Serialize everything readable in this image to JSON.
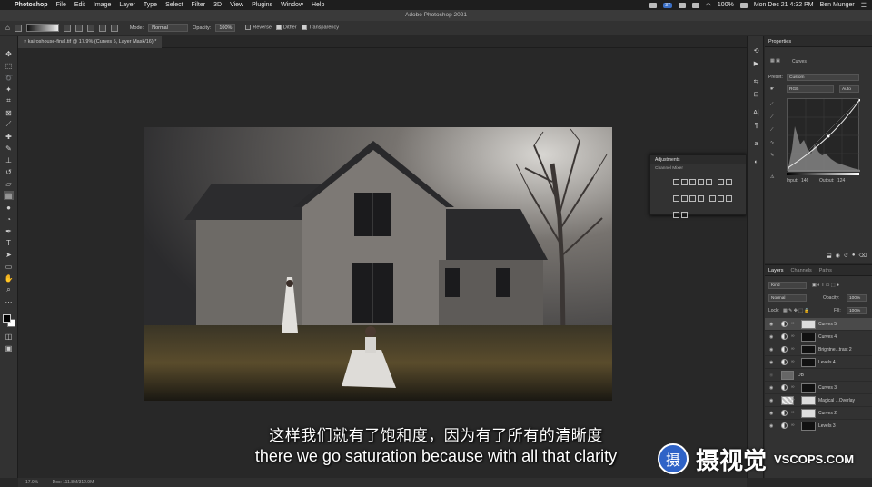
{
  "menubar": {
    "app": "Photoshop",
    "items": [
      "File",
      "Edit",
      "Image",
      "Layer",
      "Type",
      "Select",
      "Filter",
      "3D",
      "View",
      "Plugins",
      "Window",
      "Help"
    ],
    "battery": "100%",
    "datetime": "Mon Dec 21  4:32 PM",
    "user": "Ben Munger",
    "badge": "37"
  },
  "window_title": "Adobe Photoshop 2021",
  "options": {
    "mode_label": "Mode:",
    "mode_value": "Normal",
    "opacity_label": "Opacity:",
    "opacity_value": "100%",
    "reverse": "Reverse",
    "dither": "Dither",
    "transparency": "Transparency"
  },
  "document_tab": "kairoshouse-final.tif @ 17.9% (Curves 5, Layer Mask/16) *",
  "adjustments_panel": {
    "title": "Adjustments",
    "subtitle": "Channel Mixer"
  },
  "properties": {
    "title": "Properties",
    "layer_type": "Curves",
    "preset_label": "Preset:",
    "preset_value": "Custom",
    "channel_value": "RGB",
    "auto_label": "Auto",
    "input_label": "Input:",
    "input_value": "146",
    "output_label": "Output:",
    "output_value": "124"
  },
  "layers_panel": {
    "tabs": [
      "Layers",
      "Channels",
      "Paths"
    ],
    "kind": "Kind",
    "blend_mode": "Normal",
    "opacity_label": "Opacity:",
    "opacity_value": "100%",
    "lock_label": "Lock:",
    "fill_label": "Fill:",
    "fill_value": "100%",
    "rows": [
      {
        "name": "Curves 5",
        "selected": true
      },
      {
        "name": "Curves 4",
        "selected": false
      },
      {
        "name": "Brightne...trast 2",
        "selected": false
      },
      {
        "name": "Levels 4",
        "selected": false
      },
      {
        "name": "DB",
        "selected": false
      },
      {
        "name": "Curves 3",
        "selected": false
      },
      {
        "name": "Magical ...Overlay",
        "selected": false
      },
      {
        "name": "Curves 2",
        "selected": false
      },
      {
        "name": "Levels 3",
        "selected": false
      }
    ]
  },
  "status": {
    "zoom": "17.9%",
    "doc": "Doc: 111.8M/312.9M"
  },
  "subtitles": {
    "chinese": "这样我们就有了饱和度，因为有了所有的清晰度",
    "english": "there we go saturation because with all that clarity"
  },
  "watermark": {
    "chinese": "摄视觉",
    "domain": "VSCOPS.COM"
  }
}
